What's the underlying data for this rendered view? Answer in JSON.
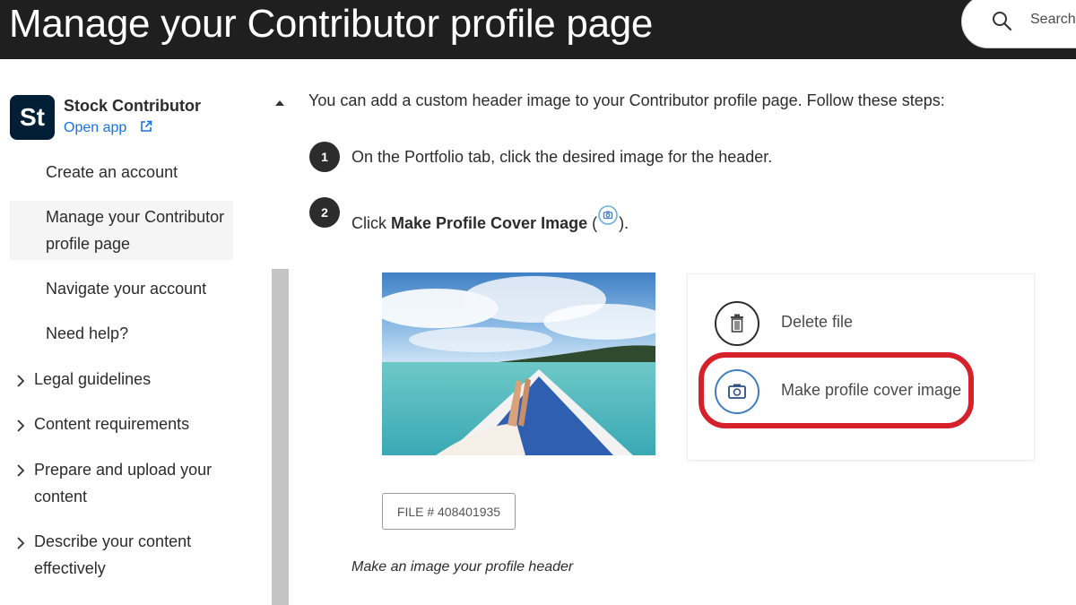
{
  "header": {
    "title": "Manage your Contributor profile page",
    "search_label": "Search"
  },
  "sidebar": {
    "product": {
      "logo_text": "St",
      "name": "Stock Contributor",
      "open_app": "Open app"
    },
    "subitems": [
      "Create an account",
      "Manage your Contributor profile page",
      "Navigate your account",
      "Need help?"
    ],
    "active_subitem": "Manage your Contributor profile page",
    "sections": [
      "Legal guidelines",
      "Content requirements",
      "Prepare and upload your content",
      "Describe your content effectively"
    ]
  },
  "main": {
    "intro": "You can add a custom header image to your Contributor profile page. Follow these steps:",
    "steps": [
      {
        "number": "1",
        "text": "On the Portfolio tab, click the desired image for the header."
      },
      {
        "number": "2",
        "prefix": "Click ",
        "bold": "Make Profile Cover Image",
        "suffix_open": " (",
        "suffix_close": ")."
      }
    ],
    "actions": [
      {
        "label": "Delete file",
        "icon": "trash-icon"
      },
      {
        "label": "Make profile cover image",
        "icon": "camera-icon",
        "highlighted": true
      }
    ],
    "file_tag": "FILE # 408401935",
    "caption": "Make an image your profile header"
  },
  "colors": {
    "header_bg": "#1f1f1f",
    "link": "#1473e6",
    "highlight": "#d6202a",
    "logo_bg": "#001e36",
    "camera_blue": "#3e7dc0"
  }
}
